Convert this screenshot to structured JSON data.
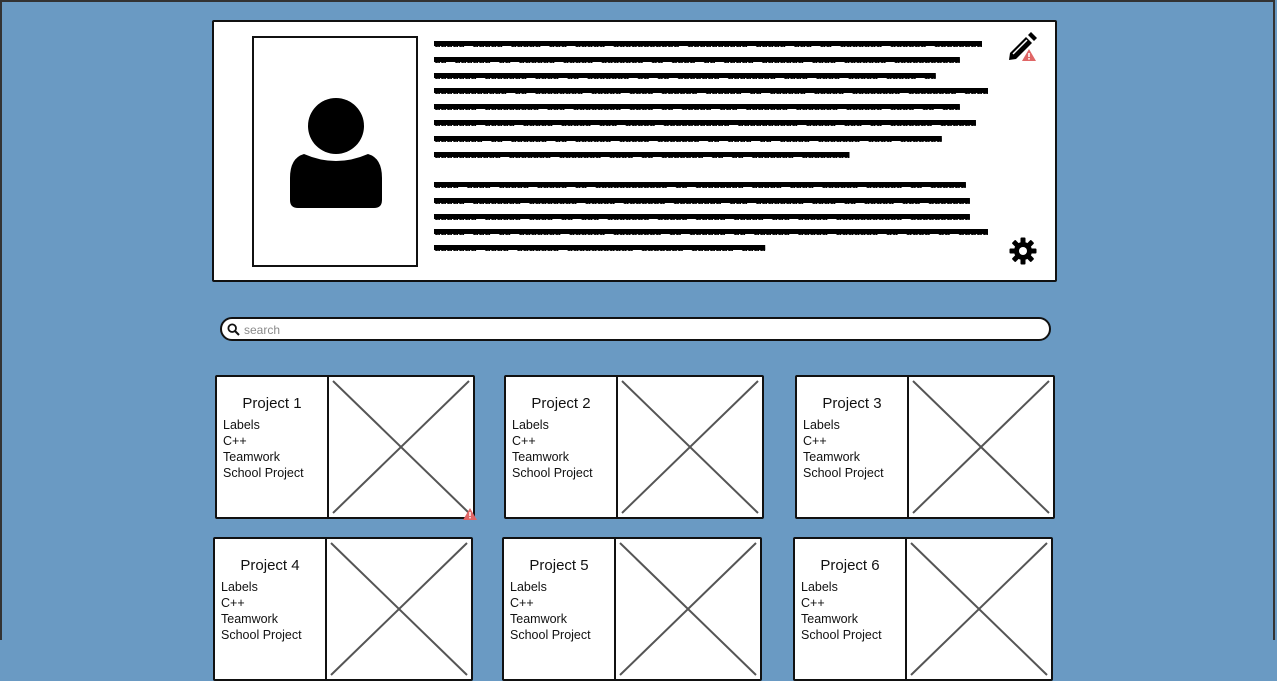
{
  "profile": {
    "bio_paragraphs": [
      "aaaaa aaaaa aaaaa aaa aaaaa aaaaaaaaaaa aaaaaaaaaa aaaaa aaa aa aaaaaaa aaaaaa aaaaaaaa aa aaaaaa aa aaaaaa aaaaa aaaaaaa aa aaaa aa aaaaa aaaaaaa aaaa aaaaaaa aaaaaaaaaaa aaaaaaa aaaaaaa aaaa aa aaaaaaa aa aa aaaaaaa aaaaaaaa aaaa aaaa aaaaa aaaaa aa aaaaaaaaaaaa aa aaaaaaaa aaaaa aaaa aaaaaa aaaaaa aa aaaaaa aaaaa aaaaaaaa aaaaaaaa aaaa aaaaaaa aaaaaaaaa aaa aaaaaaaa aaaa aa aaaaa aaa aaaaaaa aaaaaaa aaaaaa aaaa aa aaa aaaaaaa aaaaa aaaaa aaaaa aaa aaaaa aaaaaaaaaaa aaaaaaaaaa aaaaa aaa aa aaaaaaa aaaaaa aaaaaaaa aa aaaaaa aa aaaaaa aaaaa aaaaaaa aa aaaa aa aaaaa aaaaaaa aaaa aaaaaaa aaaaaaaaaaa aaaaaaa aaaaaaa aaaa aa aaaaaaa aa aa aaaaaaa aaaaaaaa",
      "aaaa aaaa aaaaa aaaaa aa aaaaaaaaaaaa aa aaaaaaaa aaaaa aaaa aaaaaa aaaaaa aa aaaaaa aaaaa aaaaaaaa aaaaaaaa aaaaa aaaaaaa aaaaaaaa aaa aaaaaaaa aaaa aa aaaaa aaa aaaaaaa aaaaaaa aaaaaa aaaa aa aaa aaaaaaa aaaaa aaaaa aaaaa aaa aaaaa aaaaaaaaaaa aaaaaaaaaa aaaaa aaa aa aaaaaaa aaaaaa aaaaaaaa aa aaaaaa aa aaaaaa aaaaa aaaaaaa aa aaaa aa aaaaa aaaaaaa aaaa aaaaaaa aaaaaaaaaaa aaaaaaa aaaaaaa aaaa"
    ],
    "avatar_icon": "person-silhouette-icon",
    "edit_icon": "pencil-icon",
    "settings_icon": "gear-icon"
  },
  "search": {
    "placeholder": "search",
    "value": ""
  },
  "projects": [
    {
      "title": "Project 1",
      "labels": [
        "Labels",
        "C++",
        "Teamwork",
        "School Project"
      ]
    },
    {
      "title": "Project 2",
      "labels": [
        "Labels",
        "C++",
        "Teamwork",
        "School Project"
      ]
    },
    {
      "title": "Project 3",
      "labels": [
        "Labels",
        "C++",
        "Teamwork",
        "School Project"
      ]
    },
    {
      "title": "Project 4",
      "labels": [
        "Labels",
        "C++",
        "Teamwork",
        "School Project"
      ]
    },
    {
      "title": "Project 5",
      "labels": [
        "Labels",
        "C++",
        "Teamwork",
        "School Project"
      ]
    },
    {
      "title": "Project 6",
      "labels": [
        "Labels",
        "C++",
        "Teamwork",
        "School Project"
      ]
    }
  ],
  "colors": {
    "background": "#6a9ac3",
    "card": "#ffffff",
    "stroke": "#111111",
    "warning": "#e06666"
  }
}
